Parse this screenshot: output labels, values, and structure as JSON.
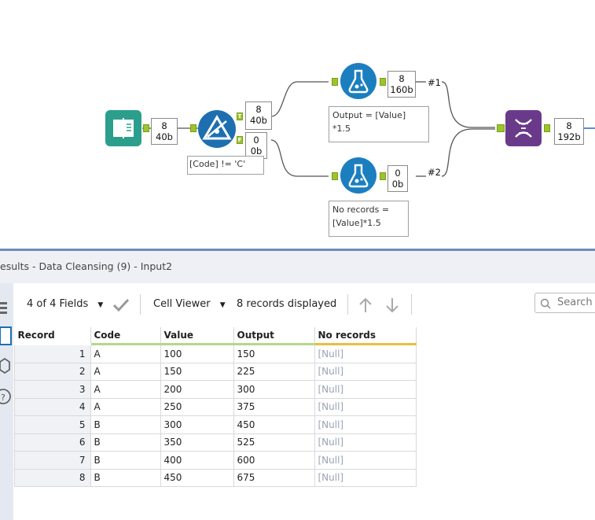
{
  "workflow": {
    "nodes": {
      "input": {
        "icon": "book-icon"
      },
      "filter": {
        "icon": "filter-icon",
        "annotation": "[Code] != 'C'"
      },
      "formula1": {
        "icon": "flask-icon",
        "annotation": "Output = [Value]\n*1.5"
      },
      "formula2": {
        "icon": "flask-icon",
        "annotation": "No records =\n[Value]*1.5"
      },
      "union": {
        "icon": "dna-icon"
      }
    },
    "boxes": {
      "input_out": {
        "count": "8",
        "size": "40b"
      },
      "filter_true": {
        "count": "8",
        "size": "40b"
      },
      "filter_false": {
        "count": "0",
        "size": "0b"
      },
      "formula1_out": {
        "count": "8",
        "size": "160b"
      },
      "formula2_out": {
        "count": "0",
        "size": "0b"
      },
      "union_out": {
        "count": "8",
        "size": "192b"
      }
    },
    "anchors": {
      "true": "T",
      "false": "F"
    },
    "connection_labels": {
      "c1": "#1",
      "c2": "#2"
    },
    "colors": {
      "input": "#2c9e8c",
      "filter": "#1d6fb0",
      "formula": "#1b7fbf",
      "union": "#6a3a8a",
      "anchor": "#9cc42c"
    }
  },
  "results": {
    "title": "esults - Data Cleansing (9) - Input2",
    "fields_label": "4 of 4 Fields",
    "viewer_label": "Cell Viewer",
    "records_label": "8 records displayed",
    "search_placeholder": "Search"
  },
  "table": {
    "columns": [
      "Record",
      "Code",
      "Value",
      "Output",
      "No records"
    ],
    "column_underline_colors": [
      "#ffffff",
      "#b6d78a",
      "#b6d78a",
      "#b6d78a",
      "#e8c040"
    ],
    "rows": [
      [
        "1",
        "A",
        "100",
        "150",
        "[Null]"
      ],
      [
        "2",
        "A",
        "150",
        "225",
        "[Null]"
      ],
      [
        "3",
        "A",
        "200",
        "300",
        "[Null]"
      ],
      [
        "4",
        "A",
        "250",
        "375",
        "[Null]"
      ],
      [
        "5",
        "B",
        "300",
        "450",
        "[Null]"
      ],
      [
        "6",
        "B",
        "350",
        "525",
        "[Null]"
      ],
      [
        "7",
        "B",
        "400",
        "600",
        "[Null]"
      ],
      [
        "8",
        "B",
        "450",
        "675",
        "[Null]"
      ]
    ]
  }
}
